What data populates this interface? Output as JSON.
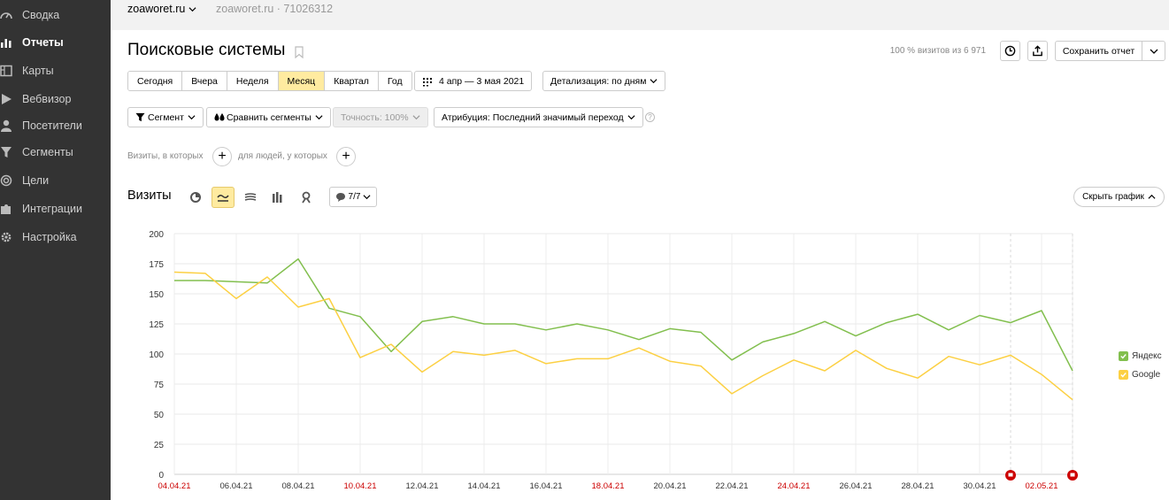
{
  "sidebar": {
    "items": [
      {
        "label": "Сводка",
        "icon": "gauge-icon",
        "active": false
      },
      {
        "label": "Отчеты",
        "icon": "bar-chart-icon",
        "active": true
      },
      {
        "label": "Карты",
        "icon": "map-icon",
        "active": false
      },
      {
        "label": "Вебвизор",
        "icon": "play-icon",
        "active": false
      },
      {
        "label": "Посетители",
        "icon": "user-icon",
        "active": false
      },
      {
        "label": "Сегменты",
        "icon": "funnel-icon",
        "active": false
      },
      {
        "label": "Цели",
        "icon": "target-icon",
        "active": false
      },
      {
        "label": "Интеграции",
        "icon": "puzzle-icon",
        "active": false
      },
      {
        "label": "Настройка",
        "icon": "gear-icon",
        "active": false
      }
    ]
  },
  "topbar": {
    "site": "zoaworet.ru",
    "counter": "zoaworet.ru · 71026312"
  },
  "report": {
    "title": "Поисковые системы",
    "visit_share": "100 % визитов из 6 971",
    "save_label": "Сохранить отчет"
  },
  "period": {
    "buttons": [
      "Сегодня",
      "Вчера",
      "Неделя",
      "Месяц",
      "Квартал",
      "Год"
    ],
    "active": "Месяц",
    "date_range": "4 апр — 3 мая 2021",
    "detail": "Детализация: по дням"
  },
  "filters": {
    "segment": "Сегмент",
    "compare": "Сравнить сегменты",
    "accuracy": "Точность: 100%",
    "attribution": "Атрибуция: Последний значимый переход"
  },
  "conditions": {
    "visits": "Визиты, в которых",
    "people": "для людей, у которых"
  },
  "chart_header": {
    "title": "Визиты",
    "annotations": "7/7",
    "hide": "Скрыть график"
  },
  "chart_data": {
    "type": "line",
    "yticks": [
      "0",
      "25",
      "50",
      "75",
      "100",
      "125",
      "150",
      "175",
      "200"
    ],
    "ylim": [
      0,
      200
    ],
    "x": [
      "04.04.21",
      "05.04.21",
      "06.04.21",
      "07.04.21",
      "08.04.21",
      "09.04.21",
      "10.04.21",
      "11.04.21",
      "12.04.21",
      "13.04.21",
      "14.04.21",
      "15.04.21",
      "16.04.21",
      "17.04.21",
      "18.04.21",
      "19.04.21",
      "20.04.21",
      "21.04.21",
      "22.04.21",
      "23.04.21",
      "24.04.21",
      "25.04.21",
      "26.04.21",
      "27.04.21",
      "28.04.21",
      "29.04.21",
      "30.04.21",
      "01.05.21",
      "02.05.21",
      "03.05.21"
    ],
    "xtick_labels": [
      {
        "label": "04.04.21",
        "weekend": true
      },
      {
        "label": "06.04.21",
        "weekend": false
      },
      {
        "label": "08.04.21",
        "weekend": false
      },
      {
        "label": "10.04.21",
        "weekend": true
      },
      {
        "label": "12.04.21",
        "weekend": false
      },
      {
        "label": "14.04.21",
        "weekend": false
      },
      {
        "label": "16.04.21",
        "weekend": false
      },
      {
        "label": "18.04.21",
        "weekend": true
      },
      {
        "label": "20.04.21",
        "weekend": false
      },
      {
        "label": "22.04.21",
        "weekend": false
      },
      {
        "label": "24.04.21",
        "weekend": true
      },
      {
        "label": "26.04.21",
        "weekend": false
      },
      {
        "label": "28.04.21",
        "weekend": false
      },
      {
        "label": "30.04.21",
        "weekend": false
      },
      {
        "label": "02.05.21",
        "weekend": true
      }
    ],
    "annotation_markers_at": [
      "01.05.21",
      "03.05.21"
    ],
    "series": [
      {
        "name": "Яндекс",
        "color": "#82bf4e",
        "values": [
          161,
          161,
          160,
          159,
          179,
          138,
          131,
          102,
          127,
          131,
          125,
          125,
          120,
          125,
          120,
          112,
          121,
          118,
          95,
          110,
          117,
          127,
          115,
          126,
          133,
          120,
          132,
          126,
          136,
          86
        ]
      },
      {
        "name": "Google",
        "color": "#fcd043",
        "values": [
          168,
          167,
          146,
          164,
          139,
          146,
          97,
          108,
          85,
          102,
          99,
          103,
          92,
          96,
          96,
          105,
          94,
          90,
          67,
          82,
          95,
          86,
          103,
          88,
          80,
          98,
          91,
          99,
          83,
          62
        ]
      }
    ]
  },
  "colors": {
    "sidebar_bg": "#333333",
    "active_button": "#ffeba0",
    "weekend_tick": "#cc0000"
  }
}
